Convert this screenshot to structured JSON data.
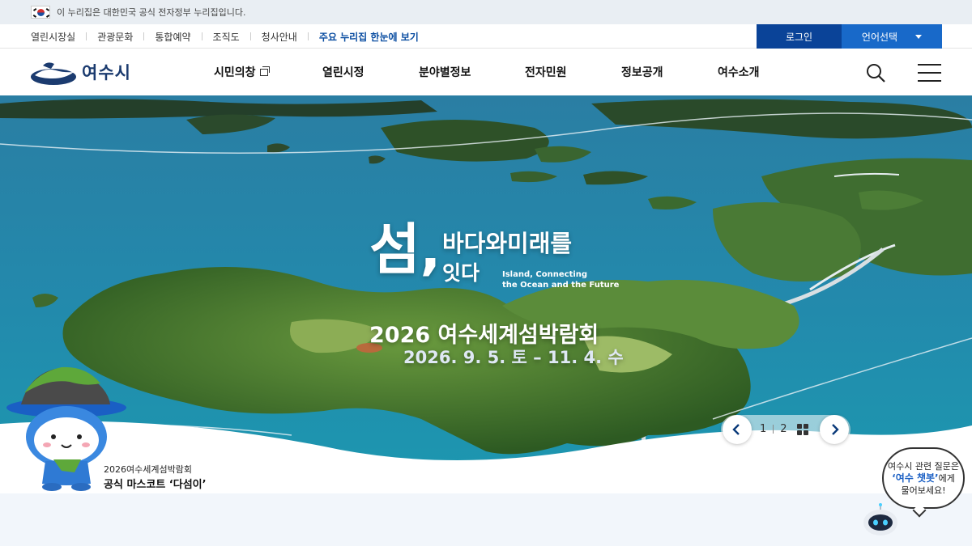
{
  "gov_banner": {
    "text": "이 누리집은 대한민국 공식 전자정부 누리집입니다."
  },
  "util": {
    "links": [
      "열린시장실",
      "관광문화",
      "통합예약",
      "조직도",
      "청사안내"
    ],
    "highlight": "주요 누리집 한눈에 보기",
    "login": "로그인",
    "language": "언어선택"
  },
  "header": {
    "logo": "여수시",
    "nav": [
      "시민의창",
      "열린시정",
      "분야별정보",
      "전자민원",
      "정보공개",
      "여수소개"
    ]
  },
  "hero": {
    "big_char": "섬,",
    "line1": "바다와미래를",
    "line2": "잇다",
    "eng_line1": "Island, Connecting",
    "eng_line2": "the Ocean and the Future",
    "expo_name": "2026 여수세계섬박람회",
    "expo_date": "2026. 9. 5. 토 – 11. 4. 수"
  },
  "slider": {
    "current": "1",
    "total": "2"
  },
  "mascot": {
    "caption_line1": "2026여수세계섬박람회",
    "caption_line2": "공식 마스코트 ‘다섬이’"
  },
  "chatbot": {
    "line1": "여수시 관련 질문은",
    "highlight": "‘여수 챗봇’",
    "line2_suffix": "에게",
    "line3": "물어보세요!"
  },
  "colors": {
    "login_bg": "#0a4398",
    "lang_bg": "#1869c9",
    "accent": "#0a4da1",
    "sea": "#1f6a8e"
  }
}
